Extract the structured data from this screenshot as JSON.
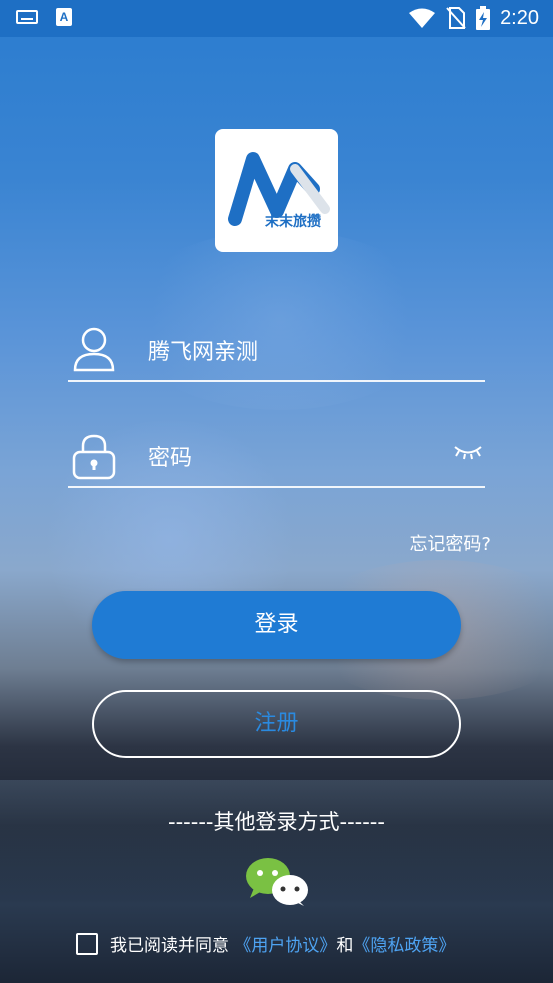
{
  "status_bar": {
    "time": "2:20"
  },
  "logo": {
    "text": "末末旅攒"
  },
  "username": {
    "value": "腾飞网亲测"
  },
  "password": {
    "placeholder": "密码"
  },
  "forgot_password": "忘记密码?",
  "login_button": "登录",
  "register_button": "注册",
  "other_login": "------其他登录方式------",
  "agreement": {
    "prefix": "我已阅读并同意",
    "user_agreement": "《用户协议》",
    "and": "和",
    "privacy_policy": "《隐私政策》"
  },
  "colors": {
    "accent": "#1f7bd4",
    "link": "#4ea3f2",
    "wechat_green": "#7ac143"
  },
  "icons": [
    "keyboard-icon",
    "a-letter-icon",
    "wifi-icon",
    "no-sim-icon",
    "battery-charging-icon",
    "user-icon",
    "lock-icon",
    "eye-closed-icon",
    "wechat-icon"
  ]
}
